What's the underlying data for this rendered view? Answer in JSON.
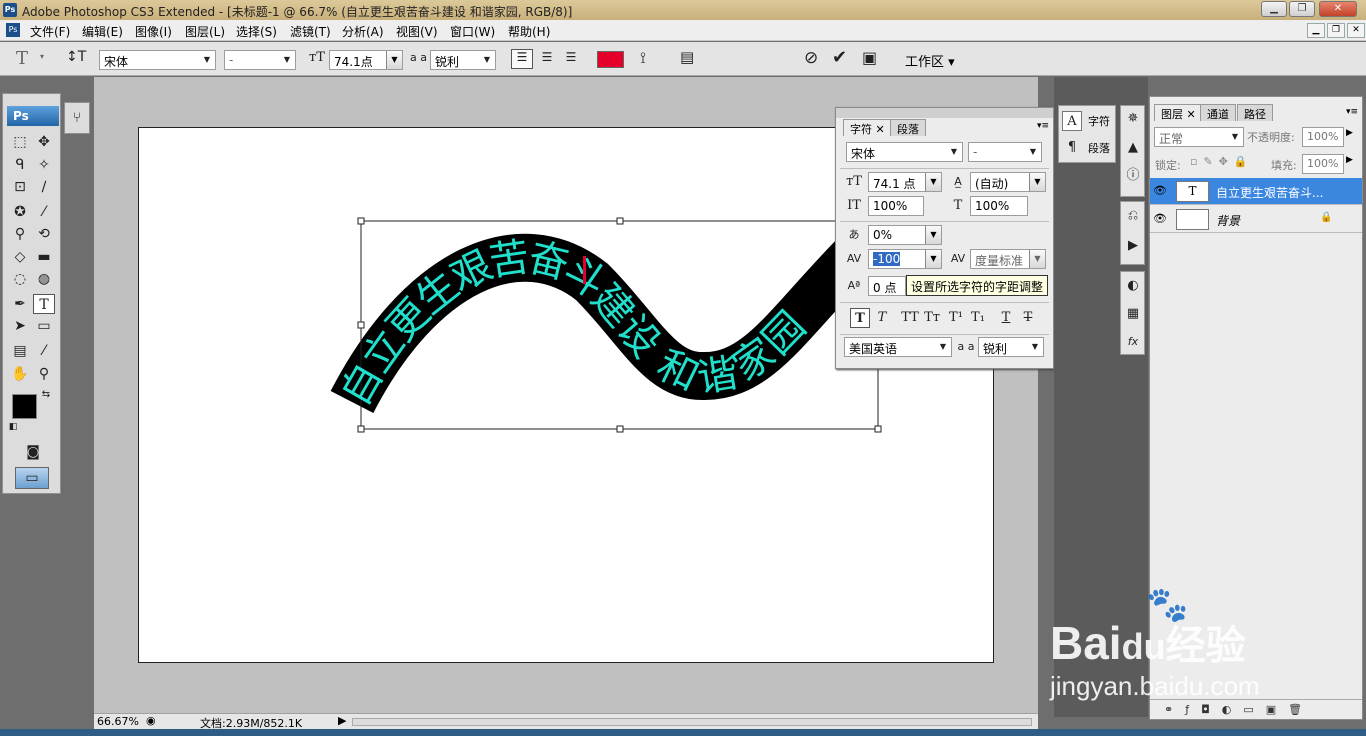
{
  "window": {
    "title": "Adobe Photoshop CS3 Extended - [未标题-1 @ 66.7% (自立更生艰苦奋斗建设 和谐家园, RGB/8)]",
    "app_icon": "Ps"
  },
  "menu": [
    "文件(F)",
    "编辑(E)",
    "图像(I)",
    "图层(L)",
    "选择(S)",
    "滤镜(T)",
    "分析(A)",
    "视图(V)",
    "窗口(W)",
    "帮助(H)"
  ],
  "options": {
    "font_family": "宋体",
    "font_style": "-",
    "font_size": "74.1点",
    "aa_label": "a a",
    "antialias": "锐利",
    "text_color": "#e4002b",
    "workspace_label": "工作区"
  },
  "toolbox": {
    "logo": "Ps"
  },
  "canvas": {
    "text": "自立更生艰苦奋斗建设 和谐家园",
    "text_color": "#20e0cc",
    "path_color": "#000000"
  },
  "status": {
    "zoom": "66.67%",
    "doc_info": "文档:2.93M/852.1K"
  },
  "char_panel": {
    "tabs": [
      "字符",
      "段落"
    ],
    "font_family": "宋体",
    "font_style": "-",
    "size": "74.1 点",
    "leading": "(自动)",
    "vscale": "100%",
    "hscale": "100%",
    "tsume": "0%",
    "tracking": "-100",
    "kerning": "度量标准",
    "baseline": "0 点",
    "color_label": "颜色:",
    "language": "美国英语",
    "aa_label": "a a",
    "antialias": "锐利"
  },
  "tooltip": "设置所选字符的字距调整",
  "dock1": {
    "char_label": "字符",
    "para_label": "段落"
  },
  "layers_panel": {
    "tabs": [
      "图层",
      "通道",
      "路径"
    ],
    "blend_mode": "正常",
    "opacity_label": "不透明度:",
    "opacity": "100%",
    "lock_label": "锁定:",
    "fill_label": "填充:",
    "fill": "100%",
    "layers": [
      {
        "name": "自立更生艰苦奋斗...",
        "thumb": "T",
        "selected": true
      },
      {
        "name": "背景",
        "thumb": "",
        "selected": false
      }
    ]
  },
  "watermark": {
    "brand": "Bai",
    "brand2": "du",
    "cn": "经验",
    "url": "jingyan.baidu.com"
  }
}
